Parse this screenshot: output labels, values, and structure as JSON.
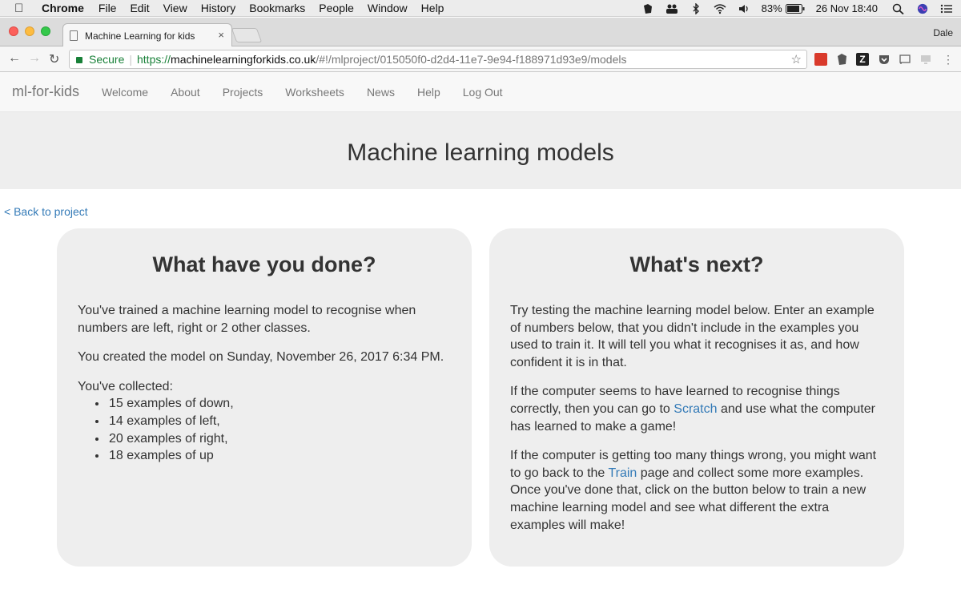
{
  "menubar": {
    "app": "Chrome",
    "items": [
      "File",
      "Edit",
      "View",
      "History",
      "Bookmarks",
      "People",
      "Window",
      "Help"
    ],
    "battery": "83%",
    "datetime": "26 Nov  18:40"
  },
  "browser": {
    "tab_title": "Machine Learning for kids",
    "tab_close": "×",
    "profile_name": "Dale",
    "secure_label": "Secure",
    "url_scheme": "https://",
    "url_host": "machinelearningforkids.co.uk",
    "url_path": "/#!/mlproject/015050f0-d2d4-11e7-9e94-f188971d93e9/models"
  },
  "site": {
    "brand": "ml-for-kids",
    "nav": [
      "Welcome",
      "About",
      "Projects",
      "Worksheets",
      "News",
      "Help",
      "Log Out"
    ],
    "page_title": "Machine learning models",
    "back_link": "< Back to project"
  },
  "done_panel": {
    "heading": "What have you done?",
    "p1": "You've trained a machine learning model to recognise when numbers are left, right or 2 other classes.",
    "p2": "You created the model on Sunday, November 26, 2017 6:34 PM.",
    "p3": "You've collected:",
    "items": [
      "15 examples of down,",
      "14 examples of left,",
      "20 examples of right,",
      "18 examples of up"
    ]
  },
  "next_panel": {
    "heading": "What's next?",
    "p1": "Try testing the machine learning model below. Enter an example of numbers below, that you didn't include in the examples you used to train it. It will tell you what it recognises it as, and how confident it is in that.",
    "p2_pre": "If the computer seems to have learned to recognise things correctly, then you can go to ",
    "p2_link": "Scratch",
    "p2_post": " and use what the computer has learned to make a game!",
    "p3_pre": "If the computer is getting too many things wrong, you might want to go back to the ",
    "p3_link": "Train",
    "p3_post": " page and collect some more examples. Once you've done that, click on the button below to train a new machine learning model and see what different the extra examples will make!"
  }
}
